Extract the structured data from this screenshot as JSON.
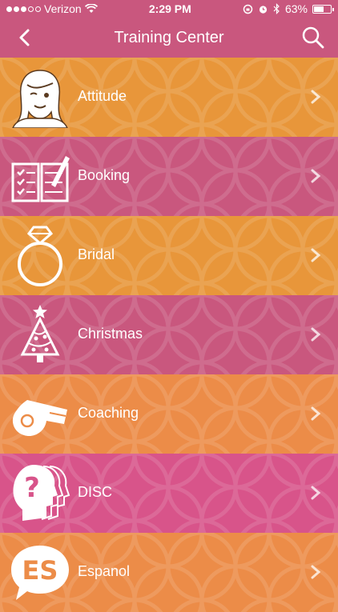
{
  "status": {
    "carrier": "Verizon",
    "time": "2:29 PM",
    "battery_text": "63%",
    "battery_level": 0.63
  },
  "header": {
    "title": "Training Center"
  },
  "colors": {
    "orange": "#e8963a",
    "pink": "#c9577e",
    "magenta": "#d8548a"
  },
  "items": [
    {
      "label": "Attitude",
      "icon": "woman-face-icon",
      "color": "#e8963a"
    },
    {
      "label": "Booking",
      "icon": "checklist-book-icon",
      "color": "#c9577e"
    },
    {
      "label": "Bridal",
      "icon": "diamond-ring-icon",
      "color": "#e8963a"
    },
    {
      "label": "Christmas",
      "icon": "christmas-tree-icon",
      "color": "#c9577e"
    },
    {
      "label": "Coaching",
      "icon": "whistle-icon",
      "color": "#ec8c48"
    },
    {
      "label": "DISC",
      "icon": "head-question-icon",
      "color": "#d8548a"
    },
    {
      "label": "Espanol",
      "icon": "es-speech-bubble-icon",
      "color": "#ec8c48"
    }
  ]
}
